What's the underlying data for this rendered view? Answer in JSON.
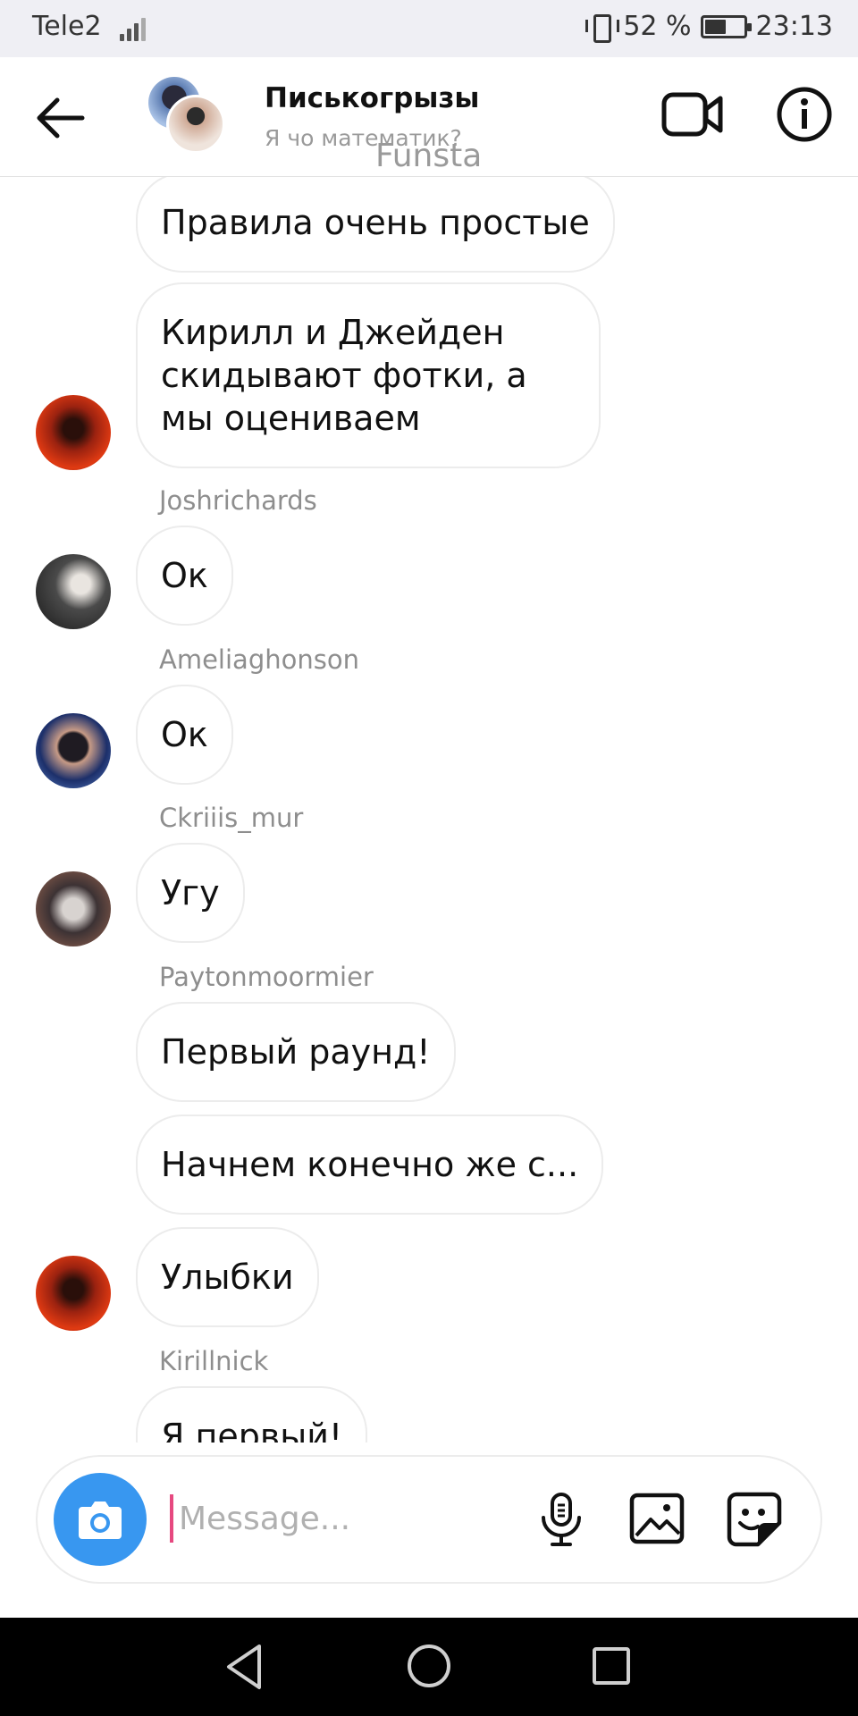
{
  "status_bar": {
    "carrier": "Tele2",
    "battery_percent": "52 %",
    "battery_level": 0.52,
    "time": "23:13",
    "icons": [
      "signal-icon",
      "vibrate-icon",
      "battery-icon"
    ]
  },
  "header": {
    "title": "Писькогрызы",
    "subtitle": "Я чо математик?",
    "watermark": "Funsta",
    "icons": [
      "back-arrow-icon",
      "video-camera-icon",
      "info-icon"
    ]
  },
  "messages": [
    {
      "text": "Правила очень простые"
    },
    {
      "text": "Кирилл и Джейден скидывают фотки, а мы оцениваем"
    },
    {
      "sender": "Joshrichards",
      "text": "Ок"
    },
    {
      "sender": "Ameliaghonson",
      "text": "Ок"
    },
    {
      "sender": "Ckriiis_mur",
      "text": "Угу"
    },
    {
      "sender": "Paytonmoormier",
      "text": "Первый раунд!"
    },
    {
      "text": "Начнем конечно же с..."
    },
    {
      "text": "Улыбки"
    },
    {
      "sender": "Kirillnick",
      "text": "Я первый!"
    }
  ],
  "composer": {
    "placeholder": "Message...",
    "accent": "#3897f0",
    "icons": [
      "camera-icon",
      "microphone-icon",
      "gallery-icon",
      "sticker-icon"
    ]
  },
  "nav_bar": {
    "icons": [
      "nav-back-icon",
      "nav-home-icon",
      "nav-recents-icon"
    ]
  }
}
